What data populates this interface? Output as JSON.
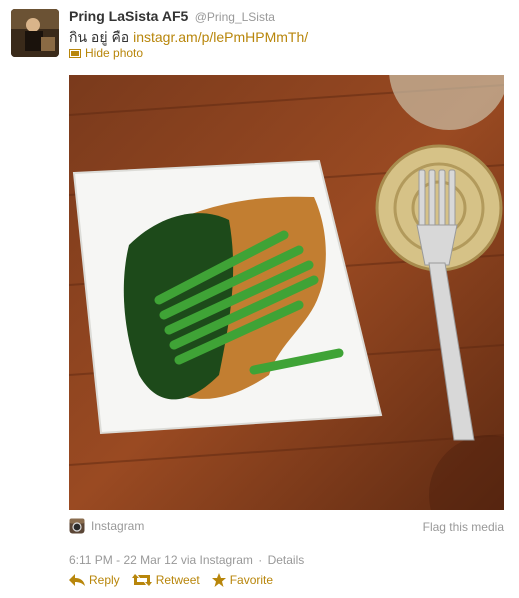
{
  "user": {
    "name": "Pring LaSista AF5",
    "handle": "@Pring_LSista"
  },
  "tweet": {
    "text_prefix": "กิน อยู่ คือ ",
    "link": "instagr.am/p/lePmHPMmTh/"
  },
  "media": {
    "hide_label": "Hide photo",
    "source_label": "Instagram",
    "flag_label": "Flag this media"
  },
  "meta": {
    "timestamp": "6:11 PM - 22 Mar 12",
    "via_prefix": "via",
    "via_app": "Instagram",
    "separator": "·",
    "details": "Details"
  },
  "actions": {
    "reply": "Reply",
    "retweet": "Retweet",
    "favorite": "Favorite"
  },
  "colors": {
    "link": "#b8860b",
    "muted": "#999999",
    "text": "#333333"
  }
}
